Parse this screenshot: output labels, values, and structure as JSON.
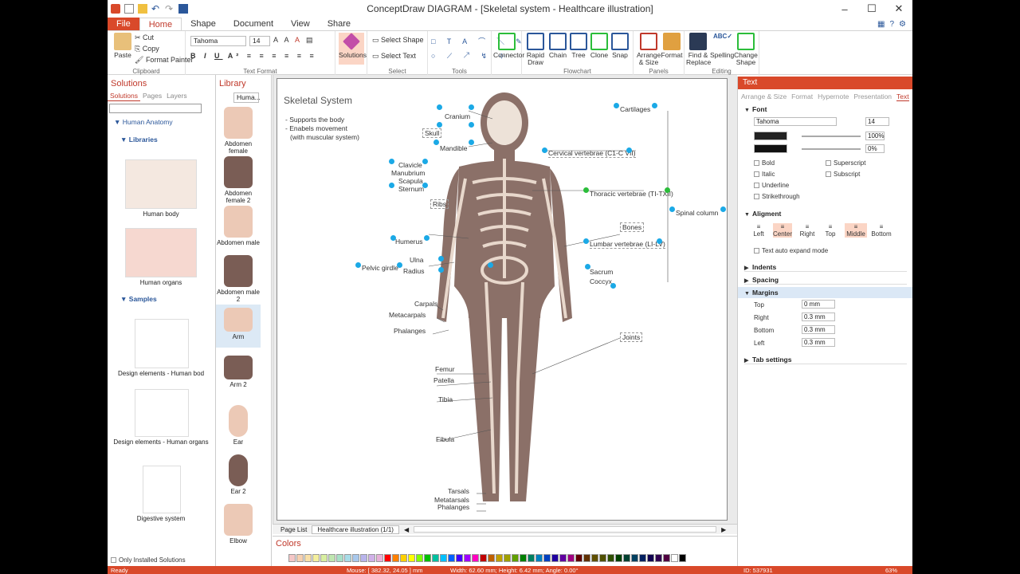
{
  "window": {
    "title": "ConceptDraw DIAGRAM - [Skeletal system - Healthcare illustration]"
  },
  "ribbon_tabs": [
    "File",
    "Home",
    "Shape",
    "Document",
    "View",
    "Share"
  ],
  "clipboard": {
    "paste": "Paste",
    "cut": "Cut",
    "copy": "Copy",
    "format_painter": "Format Painter",
    "label": "Clipboard"
  },
  "text_format": {
    "font": "Tahoma",
    "size": "14",
    "label": "Text Format"
  },
  "solutions_btn": "Solutions",
  "select": {
    "select_shape": "Select Shape",
    "select_text": "Select Text",
    "label": "Select"
  },
  "tools": {
    "label": "Tools"
  },
  "connector": "Connector",
  "flowchart": {
    "rapid_draw": "Rapid Draw",
    "chain": "Chain",
    "tree": "Tree",
    "clone": "Clone",
    "snap": "Snap",
    "label": "Flowchart"
  },
  "panels": {
    "arrange_size": "Arrange & Size",
    "format": "Format",
    "label": "Panels"
  },
  "editing": {
    "find_replace": "Find & Replace",
    "spelling": "Spelling",
    "change_shape": "Change Shape",
    "label": "Editing"
  },
  "solutions_panel": {
    "title": "Solutions",
    "tabs": [
      "Solutions",
      "Pages",
      "Layers"
    ],
    "human_anatomy": "Human Anatomy",
    "libraries": "Libraries",
    "human_body": "Human body",
    "human_organs": "Human organs",
    "samples": "Samples",
    "design_body": "Design elements - Human bod",
    "design_organs": "Design elements - Human organs",
    "digestive": "Digestive system",
    "only_installed": "Only Installed Solutions"
  },
  "library_panel": {
    "title": "Library",
    "combo": "Huma...",
    "items": [
      "Abdomen female",
      "Abdomen female 2",
      "Abdomen male",
      "Abdomen male 2",
      "Arm",
      "Arm 2",
      "Ear",
      "Ear 2",
      "Elbow"
    ]
  },
  "diagram": {
    "title": "Skeletal System",
    "bullet1": "- Supports the body",
    "bullet2": "- Enabels movement",
    "bullet3": "(with muscular system)",
    "labels": {
      "cranium": "Cranium",
      "skull": "Skull",
      "mandible": "Mandible",
      "clavicle": "Clavicle",
      "manubrium": "Manubrium",
      "scapula": "Scapula",
      "sternum": "Sternum",
      "ribs": "Ribs",
      "humerus": "Humerus",
      "ulna": "Ulna",
      "radius": "Radius",
      "pelvic_girdle": "Pelvic girdle",
      "carpals": "Carpals",
      "metacarpals": "Metacarpals",
      "phalanges": "Phalanges",
      "femur": "Femur",
      "patella": "Patella",
      "tibia": "Tibia",
      "fibula": "Fibula",
      "tarsals": "Tarsals",
      "metatarsals": "Metatarsals",
      "phalanges2": "Phalanges",
      "cartilages": "Cartilages",
      "cervical": "Cervical vertebrae (C1-C VII)",
      "thoracic": "Thoracic vertebrae (TI-TXII)",
      "spinal": "Spinal column",
      "bones": "Bones",
      "lumbar": "Lumbar vertebrae (LI-LV)",
      "sacrum": "Sacrum",
      "coccyx": "Coccyx",
      "joints": "Joints"
    }
  },
  "pagebar": {
    "page_list": "Page List",
    "page": "Healthcare illustration (1/1)"
  },
  "colors_title": "Colors",
  "status": {
    "ready": "Ready",
    "mouse": "Mouse: [ 382.32, 24.05 ] mm",
    "size": "Width: 62.60 mm; Height: 6.42 mm; Angle: 0.00°",
    "id": "ID: 537931",
    "zoom": "63%"
  },
  "text_panel": {
    "title": "Text",
    "tabs": [
      "Arrange & Size",
      "Format",
      "Hypernote",
      "Presentation",
      "Text"
    ],
    "font_section": "Font",
    "font_name": "Tahoma",
    "font_size": "14",
    "opacity1": "100%",
    "opacity2": "0%",
    "bold": "Bold",
    "italic": "Italic",
    "underline": "Underline",
    "strikethrough": "Strikethrough",
    "superscript": "Superscript",
    "subscript": "Subscript",
    "alignment": "Aligment",
    "align_btns": [
      "Left",
      "Center",
      "Right",
      "Top",
      "Middle",
      "Bottom"
    ],
    "auto_expand": "Text auto expand mode",
    "indents": "Indents",
    "spacing": "Spacing",
    "margins": "Margins",
    "margin_top_label": "Top",
    "margin_top": "0 mm",
    "margin_right_label": "Right",
    "margin_right": "0.3 mm",
    "margin_bottom_label": "Bottom",
    "margin_bottom": "0.3 mm",
    "margin_left_label": "Left",
    "margin_left": "0.3 mm",
    "tab_settings": "Tab settings"
  },
  "colors": {
    "accent": "#d9492a",
    "handle": "#1ba9e6",
    "bone": "#8b7068"
  }
}
